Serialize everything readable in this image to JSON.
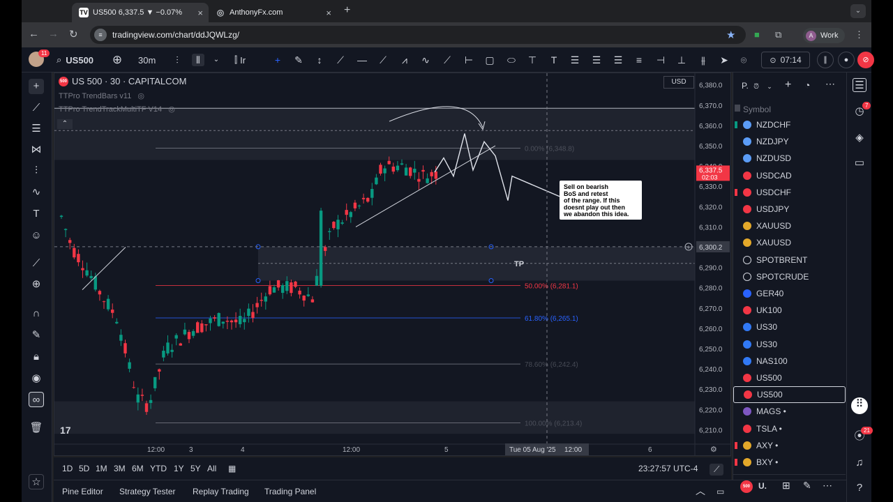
{
  "browser": {
    "tabs": [
      {
        "title": "US500 6,337.5 ▼ −0.07%",
        "favicon": "TV"
      },
      {
        "title": "AnthonyFx.com",
        "favicon": "globe-icon"
      }
    ],
    "url": "tradingview.com/chart/ddJQWLzg/",
    "profile": {
      "initial": "A",
      "label": "Work"
    }
  },
  "toolbar": {
    "avatar_badge": "11",
    "symbol": "US500",
    "interval": "30m",
    "indicators_label": "Ir",
    "timer": "07:14"
  },
  "chart": {
    "legend_title": "US 500 · 30 · CAPITALCOM",
    "symbol_logo": "500",
    "indicators": [
      "TTPro TrendBars v11",
      "TTPro TrendTrackMultiTF V14"
    ],
    "currency": "USD",
    "price_ticks": [
      "6,380.0",
      "6,370.0",
      "6,360.0",
      "6,350.0",
      "6,340.0",
      "6,330.0",
      "6,320.0",
      "6,310.0",
      "6,300.0",
      "6,290.0",
      "6,280.0",
      "6,270.0",
      "6,260.0",
      "6,250.0",
      "6,240.0",
      "6,230.0",
      "6,220.0",
      "6,210.0"
    ],
    "time_ticks": [
      "12:00",
      "3",
      "4",
      "12:00",
      "5",
      "6"
    ],
    "crosshair_time": "Tue 05 Aug '25",
    "crosshair_time2": "12:00",
    "crosshair_price": "6,300.2",
    "last_price": "6,337.5",
    "countdown": "02:03",
    "fib_levels": [
      {
        "label": "0.00% (6,348.8)",
        "color": "#787b86"
      },
      {
        "label": "50.00% (6,281.1)",
        "color": "#f23645"
      },
      {
        "label": "61.80% (6,265.1)",
        "color": "#2962ff"
      },
      {
        "label": "78.60% (6,242.4)",
        "color": "#787b86"
      },
      {
        "label": "100.00% (6,213.4)",
        "color": "#787b86"
      }
    ],
    "tp_label": "TP",
    "note": [
      "Sell on bearish",
      "BoS and retest",
      "of the range. If this",
      "doesnt play out then",
      "we abandon this idea."
    ],
    "timezone_clock": "23:27:57 UTC-4",
    "ranges": [
      "1D",
      "5D",
      "1M",
      "3M",
      "6M",
      "YTD",
      "1Y",
      "5Y",
      "All"
    ],
    "colors": {
      "up": "#089981",
      "down": "#f23645",
      "bg": "#131722"
    }
  },
  "panels": [
    "Pine Editor",
    "Strategy Tester",
    "Replay Trading",
    "Trading Panel"
  ],
  "watchlist": {
    "title": "P.",
    "column": "Symbol",
    "items": [
      {
        "symbol": "NZDCHF",
        "icon": "#5b9cf6",
        "flag": "#089981"
      },
      {
        "symbol": "NZDJPY",
        "icon": "#5b9cf6",
        "flag": ""
      },
      {
        "symbol": "NZDUSD",
        "icon": "#5b9cf6",
        "flag": ""
      },
      {
        "symbol": "USDCAD",
        "icon": "#f23645",
        "flag": ""
      },
      {
        "symbol": "USDCHF",
        "icon": "#f23645",
        "flag": "#f23645"
      },
      {
        "symbol": "USDJPY",
        "icon": "#f23645",
        "flag": ""
      },
      {
        "symbol": "XAUUSD",
        "icon": "#e3a82a",
        "flag": ""
      },
      {
        "symbol": "XAUUSD",
        "icon": "#e3a82a",
        "flag": ""
      },
      {
        "symbol": "SPOTBRENT",
        "icon": "#131722",
        "flag": ""
      },
      {
        "symbol": "SPOTCRUDE",
        "icon": "#131722",
        "flag": ""
      },
      {
        "symbol": "GER40",
        "icon": "#2962ff",
        "flag": ""
      },
      {
        "symbol": "UK100",
        "icon": "#f23645",
        "flag": ""
      },
      {
        "symbol": "US30",
        "icon": "#3179f5",
        "flag": ""
      },
      {
        "symbol": "US30",
        "icon": "#3179f5",
        "flag": ""
      },
      {
        "symbol": "NAS100",
        "icon": "#3179f5",
        "flag": ""
      },
      {
        "symbol": "US500",
        "icon": "#f23645",
        "flag": ""
      },
      {
        "symbol": "US500",
        "icon": "#f23645",
        "flag": "",
        "selected": true
      },
      {
        "symbol": "MAGS •",
        "icon": "#7e57c2",
        "flag": ""
      },
      {
        "symbol": "TSLA •",
        "icon": "#f23645",
        "flag": ""
      },
      {
        "symbol": "AXY •",
        "icon": "#e3a82a",
        "flag": "#f23645"
      },
      {
        "symbol": "BXY •",
        "icon": "#e3a82a",
        "flag": "#f23645"
      }
    ],
    "footer_symbol": "U."
  },
  "right_badges": {
    "alerts": "7",
    "notifications": "21"
  }
}
